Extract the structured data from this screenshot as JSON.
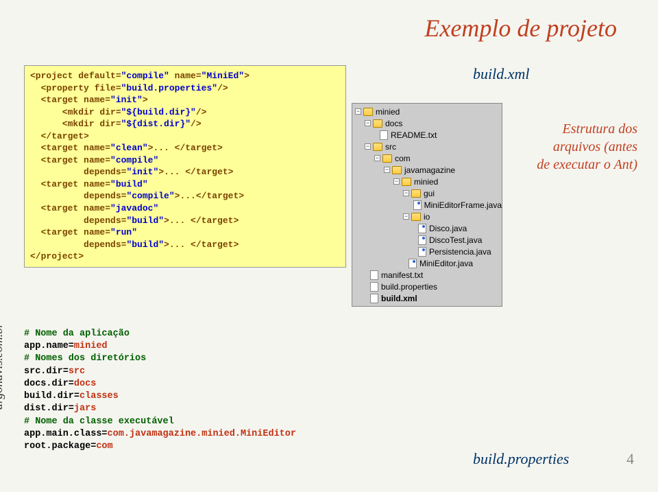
{
  "title": "Exemplo de projeto",
  "url_vertical": "argonavis.com.br",
  "build_xml_label": "build.xml",
  "build_properties_label": "build.properties",
  "estrutura_note_l1": "Estrutura dos",
  "estrutura_note_l2": "arquivos (antes",
  "estrutura_note_l3": "de executar o Ant)",
  "page_number": "4",
  "xml": {
    "l1a": "<project default=",
    "l1b": "\"compile\"",
    "l1c": " name=",
    "l1d": "\"MiniEd\"",
    "l1e": ">",
    "l2a": "  <property file=",
    "l2b": "\"build.properties\"",
    "l2c": "/>",
    "l3a": "  <target name=",
    "l3b": "\"init\"",
    "l3c": ">",
    "l4a": "      <mkdir dir=",
    "l4b": "\"${build.dir}\"",
    "l4c": "/>",
    "l5a": "      <mkdir dir=",
    "l5b": "\"${dist.dir}\"",
    "l5c": "/>",
    "l6": "  </target>",
    "l7a": "  <target name=",
    "l7b": "\"clean\"",
    "l7c": ">... </target>",
    "l8a": "  <target name=",
    "l8b": "\"compile\"",
    "l9a": "          depends=",
    "l9b": "\"init\"",
    "l9c": ">... </target>",
    "l10a": "  <target name=",
    "l10b": "\"build\"",
    "l11a": "          depends=",
    "l11b": "\"compile\"",
    "l11c": ">...</target>",
    "l12a": "  <target name=",
    "l12b": "\"javadoc\"",
    "l13a": "          depends=",
    "l13b": "\"build\"",
    "l13c": ">... </target>",
    "l14a": "  <target name=",
    "l14b": "\"run\"",
    "l15a": "          depends=",
    "l15b": "\"build\"",
    "l15c": ">... </target>",
    "l16": "</project>"
  },
  "props": {
    "c1": "# Nome da aplicação",
    "p1a": "app.name=",
    "p1b": "minied",
    "c2": "# Nomes dos diretórios",
    "p2a": "src.dir=",
    "p2b": "src",
    "p3a": "docs.dir=",
    "p3b": "docs",
    "p4a": "build.dir=",
    "p4b": "classes",
    "p5a": "dist.dir=",
    "p5b": "jars",
    "c3": "# Nome da classe executável",
    "p6a": "app.main.class=",
    "p6b": "com.javamagazine.minied.MiniEditor",
    "p7a": "root.package=",
    "p7b": "com"
  },
  "tree": {
    "n1": "minied",
    "n2": "docs",
    "n3": "README.txt",
    "n4": "src",
    "n5": "com",
    "n6": "javamagazine",
    "n7": "minied",
    "n8": "gui",
    "n9": "MiniEditorFrame.java",
    "n10": "io",
    "n11": "Disco.java",
    "n12": "DiscoTest.java",
    "n13": "Persistencia.java",
    "n14": "MiniEditor.java",
    "n15": "manifest.txt",
    "n16": "build.properties",
    "n17": "build.xml"
  }
}
